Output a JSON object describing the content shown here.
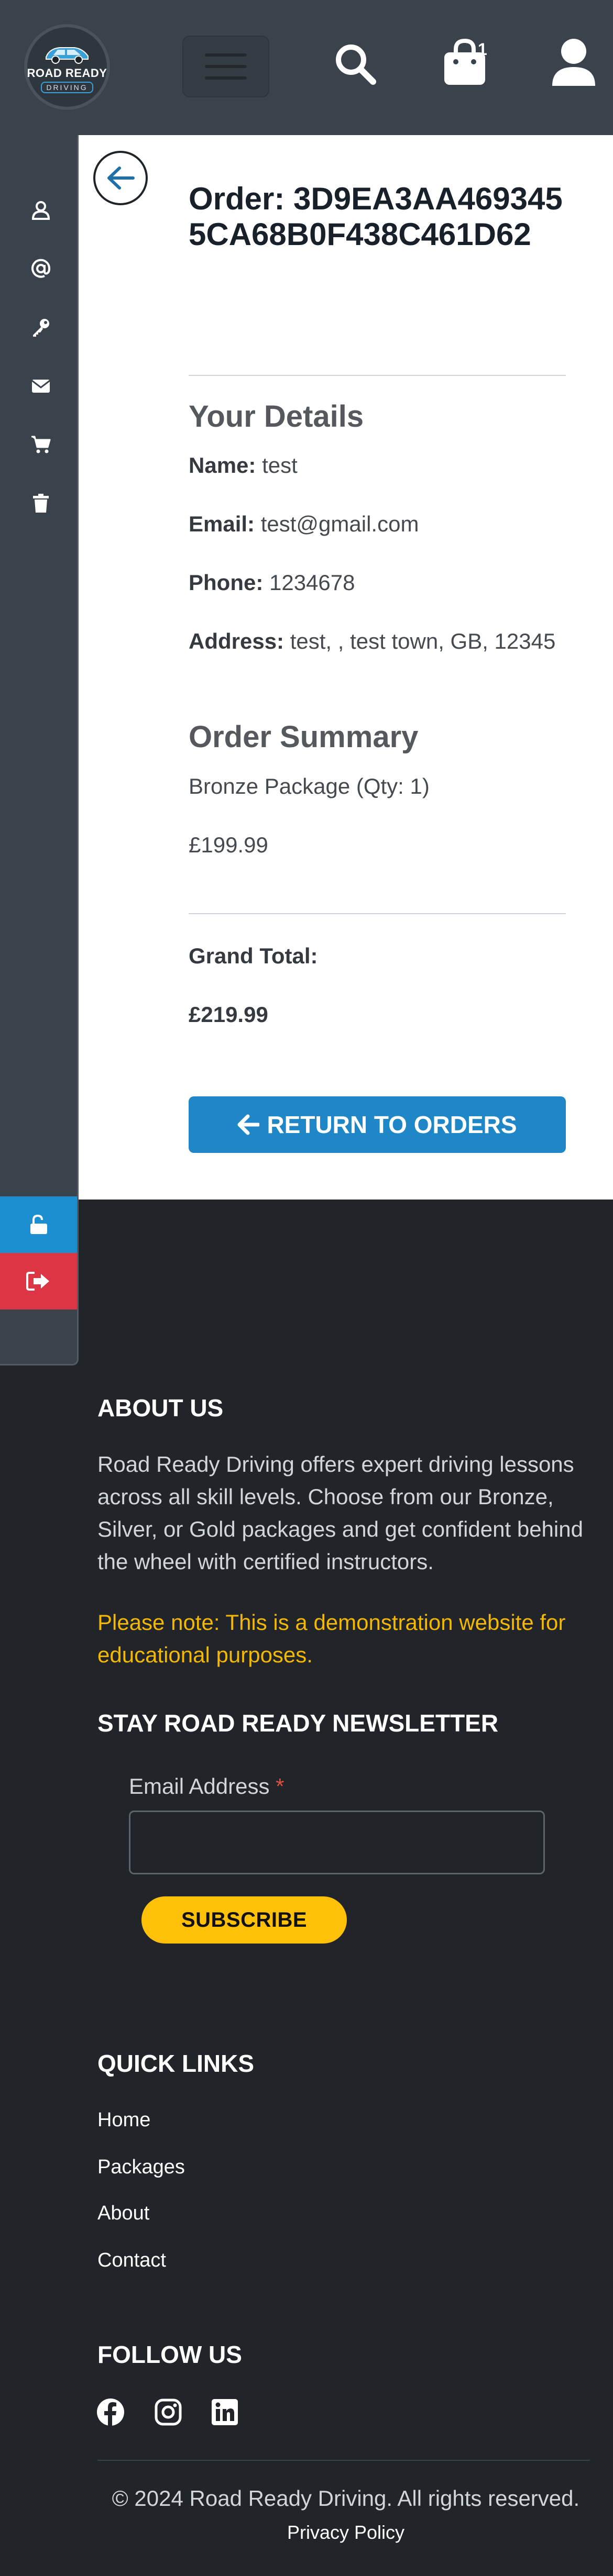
{
  "brand": {
    "logo_line1": "ROAD READY",
    "logo_line2": "DRIVING"
  },
  "navbar": {
    "cart_count": "1",
    "icons": [
      "menu-icon",
      "search-icon",
      "shopping-bag-icon",
      "user-icon"
    ]
  },
  "sidebar": {
    "items": [
      "user-icon",
      "at-sign-icon",
      "key-icon",
      "envelope-icon",
      "shopping-cart-icon",
      "trash-icon"
    ],
    "bottom_buttons": [
      "unlock-icon",
      "sign-out-icon"
    ]
  },
  "order": {
    "title": "Order: 3D9EA3AA4693455CA68B0F438C461D62",
    "details_heading": "Your Details",
    "name_label": "Name:",
    "name_value": "test",
    "email_label": "Email:",
    "email_value": "test@gmail.com",
    "phone_label": "Phone:",
    "phone_value": "1234678",
    "address_label": "Address:",
    "address_value": "test, , test town, GB, 12345",
    "summary_heading": "Order Summary",
    "item_line": "Bronze Package (Qty: 1)",
    "item_price": "£199.99",
    "grand_total_label": "Grand Total:",
    "grand_total_value": "£219.99",
    "return_button": "RETURN TO ORDERS"
  },
  "footer": {
    "about_heading": "ABOUT US",
    "about_text": "Road Ready Driving offers expert driving lessons across all skill levels. Choose from our Bronze, Silver, or Gold packages and get confident behind the wheel with certified instructors.",
    "note": "Please note: This is a demonstration website for educational purposes.",
    "newsletter_heading": "STAY ROAD READY NEWSLETTER",
    "email_label": "Email Address",
    "required_mark": "*",
    "subscribe_button": "SUBSCRIBE",
    "quick_links_heading": "QUICK LINKS",
    "quick_links": [
      "Home",
      "Packages",
      "About",
      "Contact"
    ],
    "follow_heading": "FOLLOW US",
    "social_icons": [
      "facebook-icon",
      "instagram-icon",
      "linkedin-icon"
    ],
    "copyright": "© 2024 Road Ready Driving. All rights reserved.",
    "privacy": "Privacy Policy"
  },
  "colors": {
    "navbar_bg": "#3a434c",
    "footer_bg": "#212529",
    "primary_button": "#1f87c8",
    "sidebar_blue": "#1b8fd0",
    "sidebar_red": "#dc3545",
    "accent_yellow": "#ffc107",
    "note_text": "#f5b800"
  }
}
